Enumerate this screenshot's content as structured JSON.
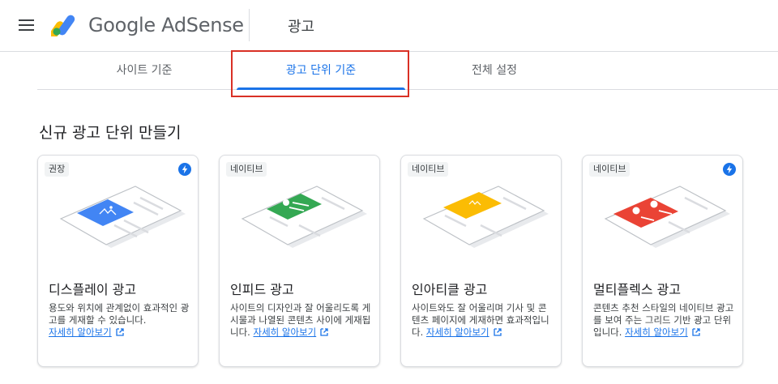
{
  "header": {
    "brand": "Google AdSense",
    "page_title": "광고"
  },
  "tabs": [
    {
      "label": "사이트 기준",
      "active": false
    },
    {
      "label": "광고 단위 기준",
      "active": true
    },
    {
      "label": "전체 설정",
      "active": false
    }
  ],
  "section_title": "신규 광고 단위 만들기",
  "cards": [
    {
      "badge": "권장",
      "title": "디스플레이 광고",
      "desc": "용도와 위치에 관계없이 효과적인 광고를 게재할 수 있습니다.",
      "learn_more": "자세히 알아보기",
      "illustration_color": "#4285f4",
      "has_bolt": true
    },
    {
      "badge": "네이티브",
      "title": "인피드 광고",
      "desc": "사이트의 디자인과 잘 어울리도록 게시물과 나열된 콘텐츠 사이에 게재됩니다.",
      "learn_more": "자세히 알아보기",
      "illustration_color": "#34a853",
      "has_bolt": false
    },
    {
      "badge": "네이티브",
      "title": "인아티클 광고",
      "desc": "사이트와도 잘 어울리며 기사 및 콘텐츠 페이지에 게재하면 효과적입니다.",
      "learn_more": "자세히 알아보기",
      "illustration_color": "#fbbc04",
      "has_bolt": false
    },
    {
      "badge": "네이티브",
      "title": "멀티플렉스 광고",
      "desc": "콘텐츠 추천 스타일의 네이티브 광고를 보여 주는 그리드 기반 광고 단위입니다.",
      "learn_more": "자세히 알아보기",
      "illustration_color": "#ea4335",
      "has_bolt": true
    }
  ],
  "colors": {
    "accent": "#1a73e8",
    "highlight_border": "#d93025",
    "bolt_badge": "#1a73e8"
  },
  "icons": {
    "menu": "hamburger-menu-icon",
    "logo": "adsense-logo-icon",
    "bolt": "auto-optimize-bolt-icon",
    "external": "open-in-new-icon"
  }
}
